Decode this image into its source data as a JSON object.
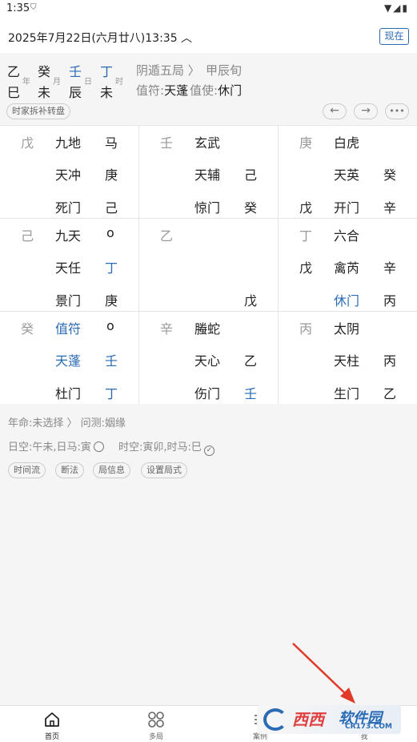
{
  "status": {
    "time": "1:35",
    "shield": "⛉",
    "right": "▼◢▮"
  },
  "date": {
    "text": "2025年7月22日(六月廿八)13:35 ︿",
    "now_label": "现在"
  },
  "pillars": {
    "stems": [
      "乙",
      "癸",
      "壬",
      "丁"
    ],
    "branches": [
      "巳",
      "未",
      "辰",
      "未"
    ],
    "labels": [
      "年",
      "月",
      "日",
      "时"
    ],
    "ju": "阴遁五局 〉",
    "xun": "甲辰旬",
    "zhifu_label": "值符:",
    "zhifu_value": "天蓬",
    "zhishi_label": "值使:",
    "zhishi_value": "休门",
    "chip": "时家拆补转盘",
    "back_icon": "←",
    "forward_icon": "→",
    "more_icon": "•••"
  },
  "palaces": [
    {
      "corner": "戊",
      "r1": [
        "九地",
        "马"
      ],
      "r2": [
        "天冲",
        "庚"
      ],
      "r3": [
        "死门",
        "己"
      ],
      "left3": ""
    },
    {
      "corner": "壬",
      "r1": [
        "玄武",
        ""
      ],
      "r2": [
        "天辅",
        "己"
      ],
      "r3": [
        "惊门",
        "癸"
      ],
      "left3": ""
    },
    {
      "corner": "庚",
      "r1": [
        "白虎",
        ""
      ],
      "r2": [
        "天英",
        "癸"
      ],
      "r3": [
        "开门",
        "辛"
      ],
      "left3": "戊"
    },
    {
      "corner": "己",
      "r1": [
        "九天",
        "o"
      ],
      "r2": [
        "天任",
        "丁"
      ],
      "r3": [
        "景门",
        "庚"
      ],
      "left3": ""
    },
    {
      "corner": "乙",
      "r1": [
        "",
        ""
      ],
      "r2": [
        "",
        ""
      ],
      "r3": [
        "",
        "戊"
      ],
      "left3": ""
    },
    {
      "corner": "丁",
      "r1": [
        "六合",
        ""
      ],
      "r2": [
        "禽芮",
        "辛"
      ],
      "r3": [
        "休门",
        "丙"
      ],
      "left2": "戊"
    },
    {
      "corner": "癸",
      "r1": [
        "值符",
        "o"
      ],
      "r2": [
        "天蓬",
        "壬"
      ],
      "r3": [
        "杜门",
        "丁"
      ],
      "left3": ""
    },
    {
      "corner": "辛",
      "r1": [
        "螣蛇",
        ""
      ],
      "r2": [
        "天心",
        "乙"
      ],
      "r3": [
        "伤门",
        "壬"
      ],
      "left3": ""
    },
    {
      "corner": "丙",
      "r1": [
        "太阴",
        ""
      ],
      "r2": [
        "天柱",
        "丙"
      ],
      "r3": [
        "生门",
        "乙"
      ],
      "left3": ""
    }
  ],
  "info": {
    "line1": "年命:未选择 〉 问测:姻缘",
    "line2a": "日空:午未,日马:寅",
    "line2b": "时空:寅卯,时马:巳",
    "chips": [
      "时间流",
      "断法",
      "局信息",
      "设置局式"
    ]
  },
  "nav": [
    {
      "label": "首页"
    },
    {
      "label": "多局"
    },
    {
      "label": "案例"
    },
    {
      "label": "我"
    }
  ],
  "watermark": {
    "brand": "西西",
    "brand2": "软件园",
    "site": "CR173.COM"
  },
  "colors": {
    "accent": "#2a6bb5",
    "arrow": "#e03a2a"
  }
}
